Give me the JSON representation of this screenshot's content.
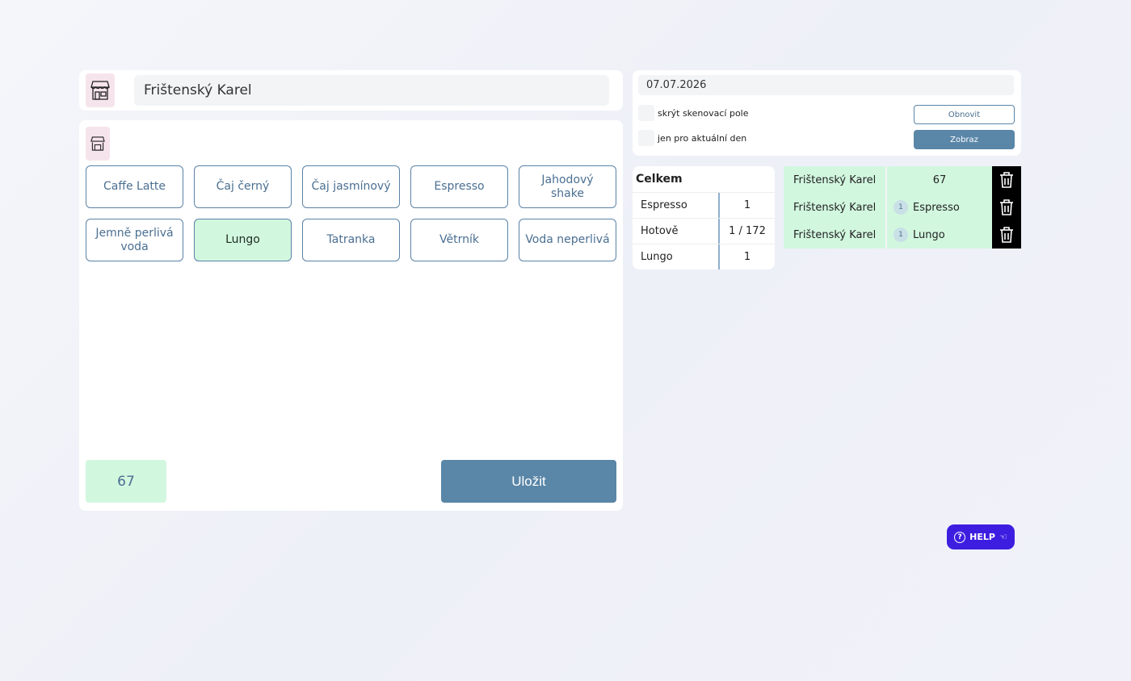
{
  "customer": {
    "name": "Frištenský Karel",
    "icon": "shop-icon"
  },
  "products": [
    {
      "label": "Caffe Latte",
      "active": false
    },
    {
      "label": "Čaj černý",
      "active": false
    },
    {
      "label": "Čaj jasmínový",
      "active": false
    },
    {
      "label": "Espresso",
      "active": false
    },
    {
      "label": "Jahodový shake",
      "active": false
    },
    {
      "label": "Jemně perlivá voda",
      "active": false
    },
    {
      "label": "Lungo",
      "active": true
    },
    {
      "label": "Tatranka",
      "active": false
    },
    {
      "label": "Větrník",
      "active": false
    },
    {
      "label": "Voda neperlivá",
      "active": false
    }
  ],
  "total": "67",
  "save_label": "Uložit",
  "filter": {
    "date": "07.07.2026",
    "hide_scan_label": "skrýt skenovací pole",
    "today_only_label": "jen pro aktuální den",
    "refresh_label": "Obnovit",
    "show_label": "Zobraz"
  },
  "summary": {
    "title": "Celkem",
    "rows": [
      {
        "label": "Espresso",
        "value": "1"
      },
      {
        "label": "Hotově",
        "value": "1 / 172"
      },
      {
        "label": "Lungo",
        "value": "1"
      }
    ]
  },
  "orders": [
    {
      "name": "Frištenský Karel",
      "qty": "",
      "item": "67"
    },
    {
      "name": "Frištenský Karel",
      "qty": "1",
      "item": "Espresso"
    },
    {
      "name": "Frištenský Karel",
      "qty": "1",
      "item": "Lungo"
    }
  ],
  "help_label": "HELP",
  "colors": {
    "accent": "#5a86a8",
    "active_green": "#d2f7df",
    "help": "#3d1ee0"
  }
}
